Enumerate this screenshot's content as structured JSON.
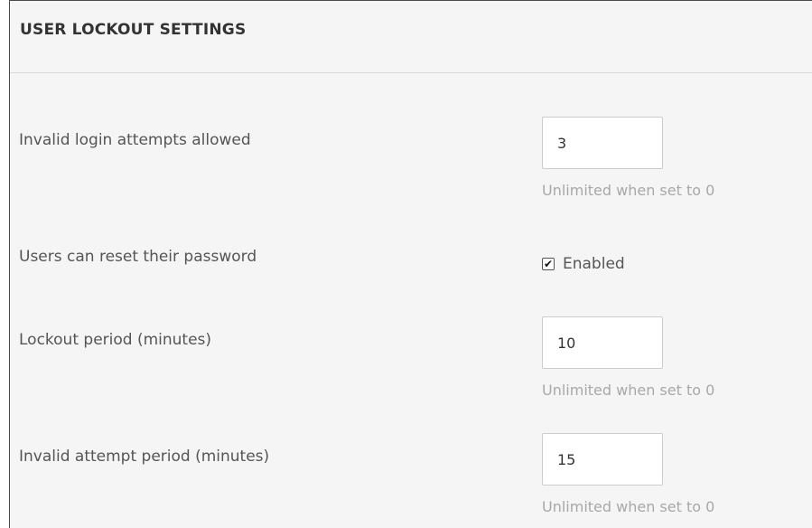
{
  "panel": {
    "title": "USER LOCKOUT SETTINGS"
  },
  "settings": {
    "invalid_login_attempts": {
      "label": "Invalid login attempts allowed",
      "value": "3",
      "hint": "Unlimited when set to 0"
    },
    "reset_password": {
      "label": "Users can reset their password",
      "checked": true,
      "checkbox_label": "Enabled"
    },
    "lockout_period": {
      "label": "Lockout period (minutes)",
      "value": "10",
      "hint": "Unlimited when set to 0"
    },
    "invalid_attempt_period": {
      "label": "Invalid attempt period (minutes)",
      "value": "15",
      "hint": "Unlimited when set to 0"
    }
  },
  "icons": {
    "checkmark": "checkmark-icon"
  }
}
